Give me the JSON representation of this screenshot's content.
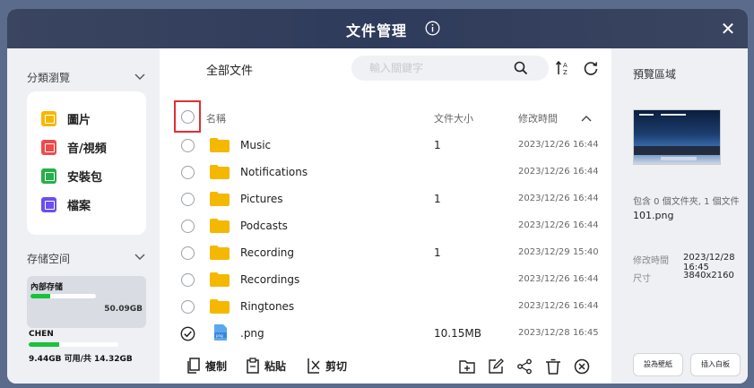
{
  "window": {
    "title": "文件管理",
    "close_label": "✕"
  },
  "sidebar": {
    "categories_header": "分類瀏覽",
    "categories": [
      {
        "label": "圖片",
        "icon": "image-icon",
        "color": "#f5b800"
      },
      {
        "label": "音/視頻",
        "icon": "media-icon",
        "color": "#f04a4a"
      },
      {
        "label": "安裝包",
        "icon": "package-icon",
        "color": "#24b04a"
      },
      {
        "label": "檔案",
        "icon": "document-icon",
        "color": "#6b4ef0"
      }
    ],
    "storage_header": "存储空间",
    "internal": {
      "label": "內部存储",
      "size": "50.09GB",
      "used_fraction": 0.3
    },
    "usb": {
      "label": "CHEN",
      "summary": "9.44GB 可用/共 14.32GB",
      "used_fraction": 0.34
    }
  },
  "main": {
    "title": "全部文件",
    "search_placeholder": "輸入關鍵字",
    "columns": {
      "name": "名稱",
      "size": "文件大小",
      "date": "修改時間"
    },
    "rows": [
      {
        "name": "Music",
        "size": "1",
        "date": "2023/12/26 16:44",
        "type": "folder",
        "selected": false
      },
      {
        "name": "Notifications",
        "size": "",
        "date": "2023/12/26 16:44",
        "type": "folder",
        "selected": false
      },
      {
        "name": "Pictures",
        "size": "1",
        "date": "2023/12/26 16:44",
        "type": "folder",
        "selected": false
      },
      {
        "name": "Podcasts",
        "size": "",
        "date": "2023/12/26 16:44",
        "type": "folder",
        "selected": false
      },
      {
        "name": "Recording",
        "size": "1",
        "date": "2023/12/29 15:40",
        "type": "folder",
        "selected": false
      },
      {
        "name": "Recordings",
        "size": "",
        "date": "2023/12/26 16:44",
        "type": "folder",
        "selected": false
      },
      {
        "name": "Ringtones",
        "size": "",
        "date": "2023/12/26 16:44",
        "type": "folder",
        "selected": false
      },
      {
        "name": ".png",
        "size": "10.15MB",
        "date": "2023/12/28 16:45",
        "type": "png",
        "selected": true
      }
    ],
    "actions": {
      "copy": "複制",
      "paste": "粘貼",
      "cut": "剪切"
    },
    "png_badge": "png"
  },
  "preview": {
    "title": "預覽區域",
    "summary": "包含 0 個文件夾, 1 個文件",
    "filename": "101.png",
    "modified_label": "修改時間",
    "modified_value": "2023/12/28 16:45",
    "size_label": "尺寸",
    "size_value": "3840x2160",
    "set_wallpaper": "設為壁紙",
    "insert_whiteboard": "插入白板"
  },
  "colors": {
    "accent_green": "#19c23a",
    "folder": "#f5b800",
    "highlight": "#e03030"
  }
}
